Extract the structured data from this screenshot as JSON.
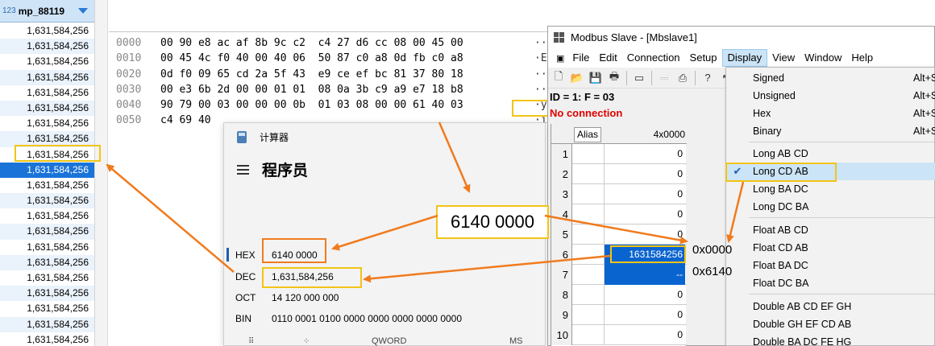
{
  "left_column": {
    "type_badge": "123",
    "header": "mp_88119",
    "rows": [
      "1,631,584,256",
      "1,631,584,256",
      "1,631,584,256",
      "1,631,584,256",
      "1,631,584,256",
      "1,631,584,256",
      "1,631,584,256",
      "1,631,584,256",
      "1,631,584,256",
      "1,631,584,256",
      "1,631,584,256",
      "1,631,584,256",
      "1,631,584,256",
      "1,631,584,256",
      "1,631,584,256",
      "1,631,584,256",
      "1,631,584,256",
      "1,631,584,256",
      "1,631,584,256",
      "1,631,584,256",
      "1,631,584,256"
    ],
    "selected_index": 9
  },
  "hex_dump": {
    "rows": [
      {
        "offset": "0000",
        "bytes": "00 90 e8 ac af 8b 9c c2  c4 27 d6 cc 08 00 45 00",
        "ascii": "··"
      },
      {
        "offset": "0010",
        "bytes": "00 45 4c f0 40 00 40 06  50 87 c0 a8 0d fb c0 a8",
        "ascii": "·EL"
      },
      {
        "offset": "0020",
        "bytes": "0d f0 09 65 cd 2a 5f 43  e9 ce ef bc 81 37 80 18",
        "ascii": "··"
      },
      {
        "offset": "0030",
        "bytes": "00 e3 6b 2d 00 00 01 01  08 0a 3b c9 a9 e7 18 b8",
        "ascii": "··"
      },
      {
        "offset": "0040",
        "bytes": "90 79 00 03 00 00 00 0b  01 03 08 00 00 61 40 03",
        "ascii": "·y"
      },
      {
        "offset": "0050",
        "bytes": "c4 69 40",
        "ascii": "·i"
      }
    ]
  },
  "calculator": {
    "window_title": "计算器",
    "mode": "程序员",
    "radix": [
      {
        "label": "HEX",
        "value": "6140 0000"
      },
      {
        "label": "DEC",
        "value": "1,631,584,256"
      },
      {
        "label": "OCT",
        "value": "14 120 000 000"
      },
      {
        "label": "BIN",
        "value": "0110 0001 0100 0000 0000 0000 0000 0000"
      }
    ],
    "word_size": "QWORD",
    "memory_label": "MS"
  },
  "modbus": {
    "window_title": "Modbus Slave - [Mbslave1]",
    "menu": [
      "File",
      "Edit",
      "Connection",
      "Setup",
      "Display",
      "View",
      "Window",
      "Help"
    ],
    "status_line": "ID = 1: F = 03",
    "connection_status": "No connection",
    "grid": {
      "col_alias": "Alias",
      "col_address": "4x0000",
      "rows": [
        {
          "n": "1",
          "value": "0"
        },
        {
          "n": "2",
          "value": "0"
        },
        {
          "n": "3",
          "value": "0"
        },
        {
          "n": "4",
          "value": "0"
        },
        {
          "n": "5",
          "value": "0"
        },
        {
          "n": "6",
          "value": "1631584256"
        },
        {
          "n": "7",
          "value": "--"
        },
        {
          "n": "8",
          "value": "0"
        },
        {
          "n": "9",
          "value": "0"
        },
        {
          "n": "10",
          "value": "0"
        }
      ]
    },
    "display_menu": {
      "items": [
        {
          "label": "Signed",
          "shortcut": "Alt+S"
        },
        {
          "label": "Unsigned",
          "shortcut": "Alt+S"
        },
        {
          "label": "Hex",
          "shortcut": "Alt+S"
        },
        {
          "label": "Binary",
          "shortcut": "Alt+S"
        },
        {
          "label": "Long AB CD",
          "shortcut": ""
        },
        {
          "label": "Long CD AB",
          "shortcut": "",
          "checked": true
        },
        {
          "label": "Long BA DC",
          "shortcut": ""
        },
        {
          "label": "Long DC BA",
          "shortcut": ""
        },
        {
          "label": "Float AB CD",
          "shortcut": ""
        },
        {
          "label": "Float CD AB",
          "shortcut": ""
        },
        {
          "label": "Float BA DC",
          "shortcut": ""
        },
        {
          "label": "Float DC BA",
          "shortcut": ""
        },
        {
          "label": "Double AB CD EF GH",
          "shortcut": ""
        },
        {
          "label": "Double GH EF CD AB",
          "shortcut": ""
        },
        {
          "label": "Double BA DC FE HG",
          "shortcut": ""
        }
      ]
    }
  },
  "annotations": {
    "callout": "6140 0000",
    "reg_low": "0x0000",
    "reg_high": "0x6140",
    "accent_color": "#f07b1e",
    "highlight_color": "#f2c417"
  }
}
